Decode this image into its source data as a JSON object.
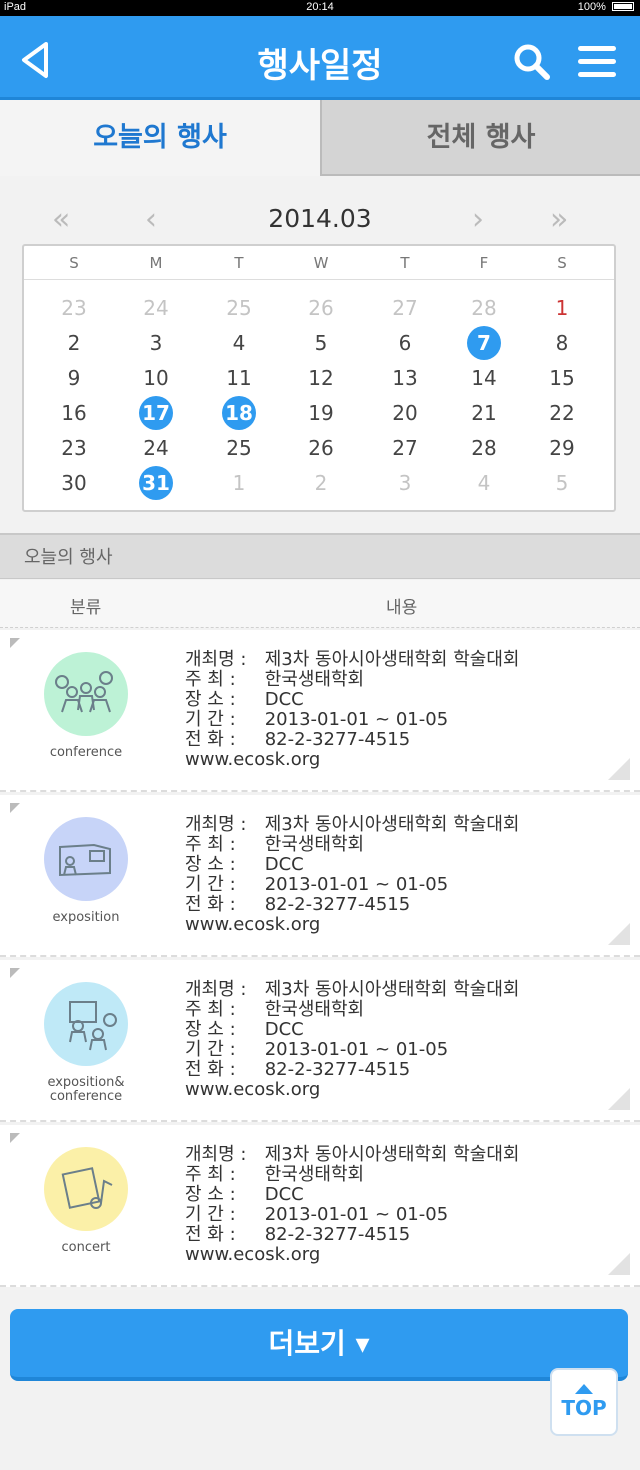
{
  "status": {
    "device": "iPad",
    "time": "20:14",
    "battery": "100%"
  },
  "header": {
    "title": "행사일정"
  },
  "tabs": {
    "today": "오늘의 행사",
    "all": "전체 행사"
  },
  "calendar": {
    "month": "2014.03",
    "weekdays": [
      "S",
      "M",
      "T",
      "W",
      "T",
      "F",
      "S"
    ],
    "weeks": [
      [
        "23",
        "24",
        "25",
        "26",
        "27",
        "28",
        "1"
      ],
      [
        "2",
        "3",
        "4",
        "5",
        "6",
        "7",
        "8"
      ],
      [
        "9",
        "10",
        "11",
        "12",
        "13",
        "14",
        "15"
      ],
      [
        "16",
        "17",
        "18",
        "19",
        "20",
        "21",
        "22"
      ],
      [
        "23",
        "24",
        "25",
        "26",
        "27",
        "28",
        "29"
      ],
      [
        "30",
        "31",
        "1",
        "2",
        "3",
        "4",
        "5"
      ]
    ],
    "event_days": [
      "7",
      "17",
      "18",
      "31"
    ]
  },
  "section": {
    "title": "오늘의 행사"
  },
  "columns": {
    "category": "분류",
    "content": "내용"
  },
  "labels": {
    "name": "개최명 :",
    "host": "주  최 :",
    "venue": "장  소 :",
    "period": "기  간 :",
    "phone": "전  화 :"
  },
  "events": [
    {
      "category": "conference",
      "name": "제3차 동아시아생태학회 학술대회",
      "host": "한국생태학회",
      "venue": "DCC",
      "period": "2013-01-01 ~ 01-05",
      "phone": "82-2-3277-4515",
      "website": "www.ecosk.org",
      "color": "#bdf2d6"
    },
    {
      "category": "exposition",
      "name": "제3차 동아시아생태학회 학술대회",
      "host": "한국생태학회",
      "venue": "DCC",
      "period": "2013-01-01 ~ 01-05",
      "phone": "82-2-3277-4515",
      "website": "www.ecosk.org",
      "color": "#c7d4f8"
    },
    {
      "category": "exposition&\nconference",
      "name": "제3차 동아시아생태학회 학술대회",
      "host": "한국생태학회",
      "venue": "DCC",
      "period": "2013-01-01 ~ 01-05",
      "phone": "82-2-3277-4515",
      "website": "www.ecosk.org",
      "color": "#bfe9f7"
    },
    {
      "category": "concert",
      "name": "제3차 동아시아생태학회 학술대회",
      "host": "한국생태학회",
      "venue": "DCC",
      "period": "2013-01-01 ~ 01-05",
      "phone": "82-2-3277-4515",
      "website": "www.ecosk.org",
      "color": "#fbf0a8"
    }
  ],
  "more_button": "더보기 ▾",
  "top_button": "TOP",
  "colors": {
    "primary": "#2f9bf0",
    "sunday_red": "#cc3333"
  }
}
